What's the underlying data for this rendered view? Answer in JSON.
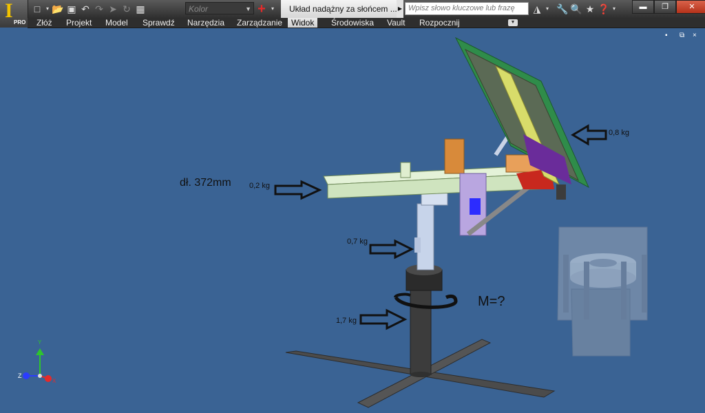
{
  "app": {
    "badge": "PRO",
    "logo": "I"
  },
  "quick_access": {
    "icons": [
      "new-icon",
      "new-dropdown-icon",
      "open-icon",
      "save-icon",
      "undo-icon",
      "redo-icon",
      "select-icon",
      "update-icon",
      "material-icon"
    ],
    "color_combo": "Kolor"
  },
  "document": {
    "title": "Układ nadążny za słońcem ..."
  },
  "search": {
    "placeholder": "Wpisz słowo kluczowe lub frazę"
  },
  "menu": {
    "items": [
      "Złóż",
      "Projekt",
      "Model",
      "Sprawdź",
      "Narzędzia",
      "Zarządzanie",
      "Widok",
      "Środowiska",
      "Vault",
      "Rozpocznij"
    ],
    "active": "Widok"
  },
  "viewport": {
    "window_controls": [
      "▪",
      "⧉",
      "×"
    ],
    "annotations": {
      "length": "dł. 372mm",
      "beam_mass": "0,2 kg",
      "panel_mass": "0,8 kg",
      "column_mass": "0,7 kg",
      "base_mass": "1,7 kg",
      "moment": "M=?"
    },
    "axes": {
      "y": "Y",
      "z": "Z",
      "x": "X"
    }
  },
  "colors": {
    "background": "#3a6394",
    "beam": "#d7ecc8",
    "panel_frame": "#2f8c4a",
    "accent_red": "#c8281e"
  }
}
